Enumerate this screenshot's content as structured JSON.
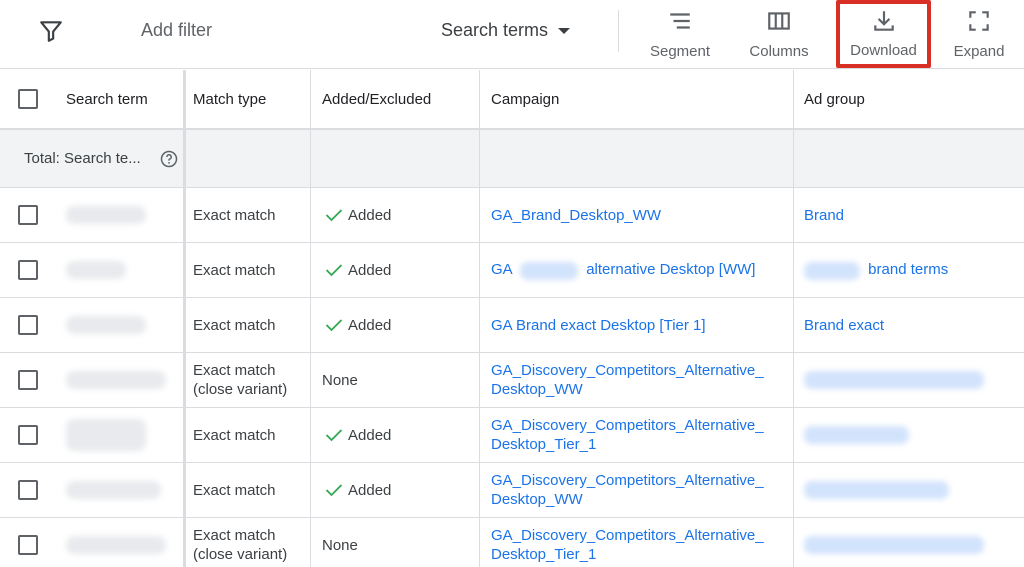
{
  "toolbar": {
    "add_filter": "Add filter",
    "search_terms": "Search terms",
    "segment": "Segment",
    "columns": "Columns",
    "download": "Download",
    "expand": "Expand"
  },
  "table": {
    "headers": {
      "search_term": "Search term",
      "match_type": "Match type",
      "added_excluded": "Added/Excluded",
      "campaign": "Campaign",
      "ad_group": "Ad group"
    },
    "total_label": "Total: Search te...",
    "rows": [
      {
        "match_type": "Exact match",
        "status": "Added",
        "campaign": "GA_Brand_Desktop_WW",
        "ad_group": "Brand"
      },
      {
        "match_type": "Exact match",
        "status": "Added",
        "campaign_prefix": "GA",
        "campaign": "alternative Desktop [WW]",
        "ad_group": "brand terms"
      },
      {
        "match_type": "Exact match",
        "status": "Added",
        "campaign": "GA Brand exact Desktop [Tier 1]",
        "ad_group": "Brand exact"
      },
      {
        "match_type": "Exact match",
        "match_type_2": "(close variant)",
        "status": "None",
        "campaign": "GA_Discovery_Competitors_Alternative_",
        "campaign_2": "Desktop_WW"
      },
      {
        "match_type": "Exact match",
        "status": "Added",
        "campaign": "GA_Discovery_Competitors_Alternative_",
        "campaign_2": "Desktop_Tier_1"
      },
      {
        "match_type": "Exact match",
        "status": "Added",
        "campaign": "GA_Discovery_Competitors_Alternative_",
        "campaign_2": "Desktop_WW"
      },
      {
        "match_type": "Exact match",
        "match_type_2": "(close variant)",
        "status": "None",
        "campaign": "GA_Discovery_Competitors_Alternative_",
        "campaign_2": "Desktop_Tier_1"
      }
    ]
  },
  "colors": {
    "link": "#1a73e8",
    "check": "#34a853",
    "highlight": "#d93025"
  }
}
